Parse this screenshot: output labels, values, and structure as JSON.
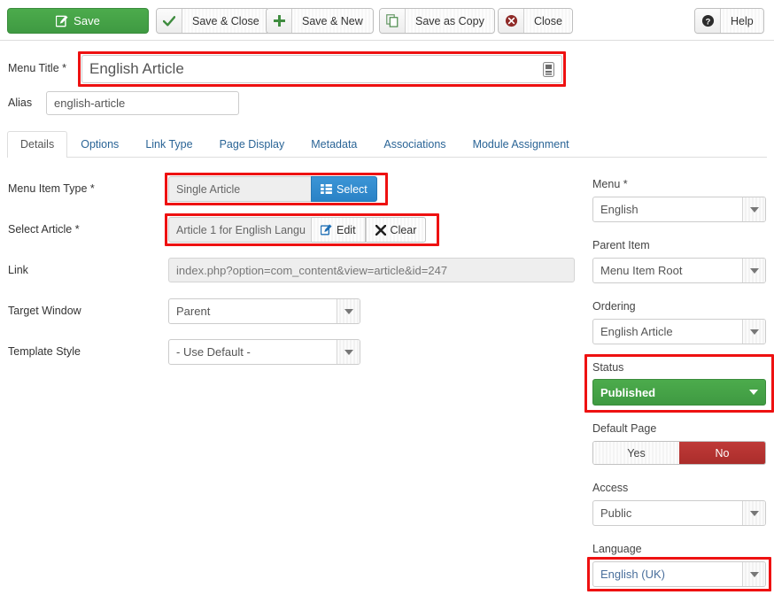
{
  "toolbar": {
    "save": {
      "label": "Save",
      "icon": "save-pencil-icon"
    },
    "save_close": {
      "label": "Save & Close",
      "icon": "check-icon"
    },
    "save_new": {
      "label": "Save & New",
      "icon": "plus-icon"
    },
    "save_copy": {
      "label": "Save as Copy",
      "icon": "copy-icon"
    },
    "close": {
      "label": "Close",
      "icon": "close-circle-icon"
    },
    "help": {
      "label": "Help",
      "icon": "help-circle-icon"
    }
  },
  "form": {
    "menu_title_label": "Menu Title *",
    "menu_title_value": "English Article",
    "alias_label": "Alias",
    "alias_value": "english-article",
    "menu_item_type_label": "Menu Item Type *",
    "menu_item_type_value": "Single Article",
    "select_button": "Select",
    "select_article_label": "Select Article *",
    "select_article_value": "Article 1 for English Langu",
    "edit_button": "Edit",
    "clear_button": "Clear",
    "link_label": "Link",
    "link_value": "index.php?option=com_content&view=article&id=247",
    "target_window_label": "Target Window",
    "target_window_value": "Parent",
    "template_style_label": "Template Style",
    "template_style_value": "- Use Default -"
  },
  "tabs": [
    {
      "label": "Details",
      "active": true
    },
    {
      "label": "Options",
      "active": false
    },
    {
      "label": "Link Type",
      "active": false
    },
    {
      "label": "Page Display",
      "active": false
    },
    {
      "label": "Metadata",
      "active": false
    },
    {
      "label": "Associations",
      "active": false
    },
    {
      "label": "Module Assignment",
      "active": false
    }
  ],
  "sidebar": {
    "menu_label": "Menu *",
    "menu_value": "English",
    "parent_label": "Parent Item",
    "parent_value": "Menu Item Root",
    "ordering_label": "Ordering",
    "ordering_value": "English Article",
    "status_label": "Status",
    "status_value": "Published",
    "default_page_label": "Default Page",
    "default_yes": "Yes",
    "default_no": "No",
    "access_label": "Access",
    "access_value": "Public",
    "language_label": "Language",
    "language_value": "English (UK)"
  },
  "colors": {
    "save_green": "#3f9a42",
    "status_green": "#44a047",
    "select_blue": "#2a82c6",
    "no_red": "#b33331",
    "highlight_red": "#ee1111",
    "tab_link": "#2a6496",
    "language_text": "#4a6f9c"
  }
}
